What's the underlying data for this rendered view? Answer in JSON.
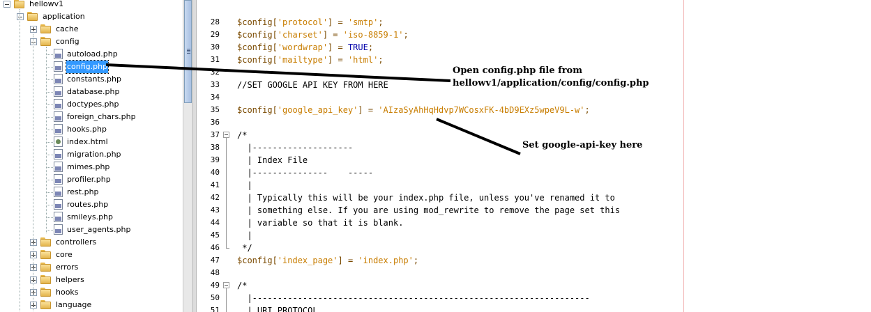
{
  "tree": {
    "root": "hellowv1",
    "application": "application",
    "cache": "cache",
    "config": "config",
    "config_files": [
      {
        "name": "autoload.php",
        "type": "php"
      },
      {
        "name": "config.php",
        "type": "php",
        "selected": true
      },
      {
        "name": "constants.php",
        "type": "php"
      },
      {
        "name": "database.php",
        "type": "php"
      },
      {
        "name": "doctypes.php",
        "type": "php"
      },
      {
        "name": "foreign_chars.php",
        "type": "php"
      },
      {
        "name": "hooks.php",
        "type": "php"
      },
      {
        "name": "index.html",
        "type": "html"
      },
      {
        "name": "migration.php",
        "type": "php"
      },
      {
        "name": "mimes.php",
        "type": "php"
      },
      {
        "name": "profiler.php",
        "type": "php"
      },
      {
        "name": "rest.php",
        "type": "php"
      },
      {
        "name": "routes.php",
        "type": "php"
      },
      {
        "name": "smileys.php",
        "type": "php"
      },
      {
        "name": "user_agents.php",
        "type": "php"
      }
    ],
    "folders_after": [
      "controllers",
      "core",
      "errors",
      "helpers",
      "hooks",
      "language"
    ]
  },
  "editor": {
    "lines": [
      {
        "n": "28",
        "tokens": [
          [
            "var",
            "$config["
          ],
          [
            "str",
            "'protocol'"
          ],
          [
            "var",
            "] = "
          ],
          [
            "str",
            "'smtp'"
          ],
          [
            "var",
            ";"
          ]
        ]
      },
      {
        "n": "29",
        "tokens": [
          [
            "var",
            "$config["
          ],
          [
            "str",
            "'charset'"
          ],
          [
            "var",
            "] = "
          ],
          [
            "str",
            "'iso-8859-1'"
          ],
          [
            "var",
            ";"
          ]
        ]
      },
      {
        "n": "30",
        "tokens": [
          [
            "var",
            "$config["
          ],
          [
            "str",
            "'wordwrap'"
          ],
          [
            "var",
            "] = "
          ],
          [
            "kw",
            "TRUE"
          ],
          [
            "var",
            ";"
          ]
        ]
      },
      {
        "n": "31",
        "tokens": [
          [
            "var",
            "$config["
          ],
          [
            "str",
            "'mailtype'"
          ],
          [
            "var",
            "] = "
          ],
          [
            "str",
            "'html'"
          ],
          [
            "var",
            ";"
          ]
        ]
      },
      {
        "n": "32",
        "tokens": []
      },
      {
        "n": "33",
        "tokens": [
          [
            "cm",
            "//SET GOOGLE API KEY FROM HERE"
          ]
        ]
      },
      {
        "n": "34",
        "tokens": []
      },
      {
        "n": "35",
        "tokens": [
          [
            "var",
            "$config["
          ],
          [
            "str",
            "'google_api_key'"
          ],
          [
            "var",
            "] = "
          ],
          [
            "str",
            "'AIzaSyAhHqHdvp7WCosxFK-4bD9EXz5wpeV9L-w'"
          ],
          [
            "var",
            ";"
          ]
        ]
      },
      {
        "n": "36",
        "tokens": []
      },
      {
        "n": "37",
        "tokens": [
          [
            "cm",
            "/*"
          ]
        ]
      },
      {
        "n": "38",
        "tokens": [
          [
            "cm",
            "  |--------------------"
          ]
        ]
      },
      {
        "n": "39",
        "tokens": [
          [
            "cm",
            "  | Index File"
          ]
        ]
      },
      {
        "n": "40",
        "tokens": [
          [
            "cm",
            "  |---------------    -----"
          ]
        ]
      },
      {
        "n": "41",
        "tokens": [
          [
            "cm",
            "  |"
          ]
        ]
      },
      {
        "n": "42",
        "tokens": [
          [
            "cm",
            "  | Typically this will be your index.php file, unless you've renamed it to"
          ]
        ]
      },
      {
        "n": "43",
        "tokens": [
          [
            "cm",
            "  | something else. If you are using mod_rewrite to remove the page set this"
          ]
        ]
      },
      {
        "n": "44",
        "tokens": [
          [
            "cm",
            "  | variable so that it is blank."
          ]
        ]
      },
      {
        "n": "45",
        "tokens": [
          [
            "cm",
            "  |"
          ]
        ]
      },
      {
        "n": "46",
        "tokens": [
          [
            "cm",
            " */"
          ]
        ]
      },
      {
        "n": "47",
        "tokens": [
          [
            "var",
            "$config["
          ],
          [
            "str",
            "'index_page'"
          ],
          [
            "var",
            "] = "
          ],
          [
            "str",
            "'index.php'"
          ],
          [
            "var",
            ";"
          ]
        ]
      },
      {
        "n": "48",
        "tokens": []
      },
      {
        "n": "49",
        "tokens": [
          [
            "cm",
            "/*"
          ]
        ]
      },
      {
        "n": "50",
        "tokens": [
          [
            "cm",
            "  |-------------------------------------------------------------------"
          ]
        ]
      },
      {
        "n": "51",
        "tokens": [
          [
            "cm",
            "  | URI PROTOCOL"
          ]
        ]
      }
    ]
  },
  "annotations": {
    "open_line1": "Open config.php file from",
    "open_line2": "hellowv1/application/config/config.php",
    "set_key": "Set google-api-key here"
  }
}
